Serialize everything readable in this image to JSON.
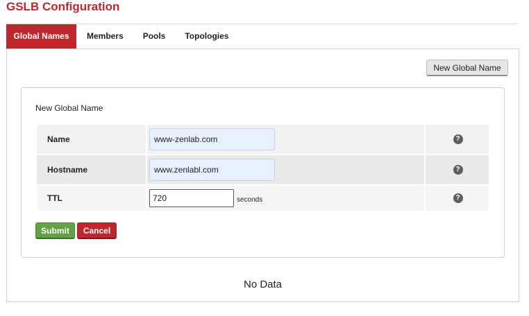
{
  "page": {
    "title": "GSLB Configuration"
  },
  "tabs": [
    {
      "label": "Global Names",
      "active": true
    },
    {
      "label": "Members",
      "active": false
    },
    {
      "label": "Pools",
      "active": false
    },
    {
      "label": "Topologies",
      "active": false
    }
  ],
  "toolbar": {
    "new_global_name_label": "New Global Name"
  },
  "form": {
    "title": "New Global Name",
    "fields": {
      "name": {
        "label": "Name",
        "value": "www-zenlab.com"
      },
      "hostname": {
        "label": "Hostname",
        "value": "www.zenlabl.com"
      },
      "ttl": {
        "label": "TTL",
        "value": "720",
        "unit": "seconds"
      }
    },
    "help_glyph": "?",
    "submit_label": "Submit",
    "cancel_label": "Cancel"
  },
  "table": {
    "empty_text": "No Data"
  },
  "colors": {
    "brand": "#c0272d",
    "submit": "#62a145",
    "autofill": "#e8f0fe"
  },
  "icons": {
    "help": "question-circle-icon"
  }
}
